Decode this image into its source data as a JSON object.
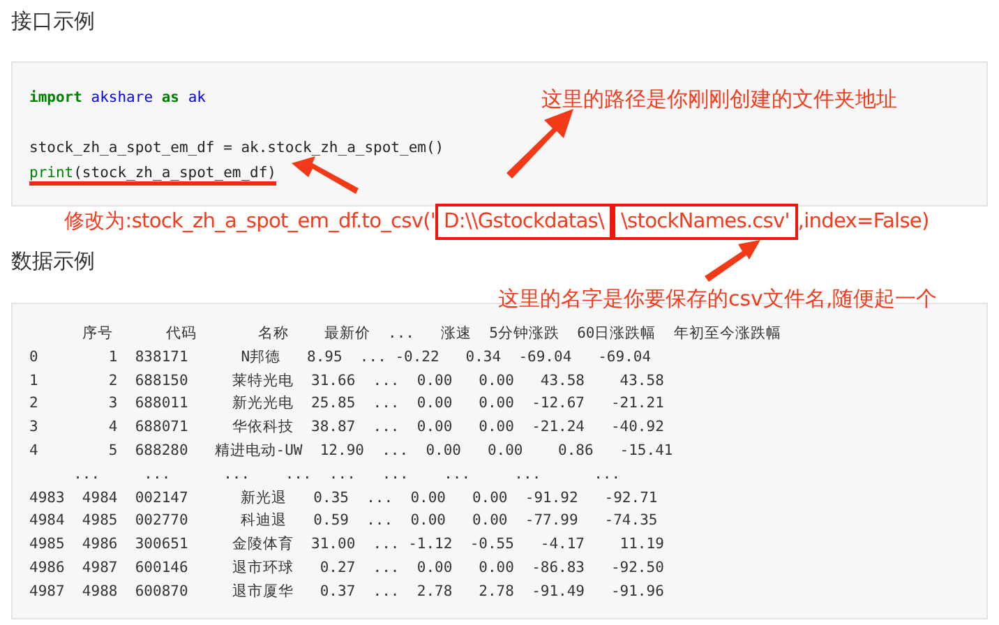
{
  "sections": [
    {
      "title": "接口示例"
    },
    {
      "title": "数据示例"
    }
  ],
  "code": {
    "blocks": [
      {
        "lines": [
          {
            "struck": false,
            "tokens": [
              {
                "kind": "keyword",
                "text": "import"
              },
              {
                "kind": "name",
                "text": "akshare"
              },
              {
                "kind": "keyword",
                "text": "as"
              },
              {
                "kind": "name",
                "text": "ak"
              }
            ]
          }
        ]
      },
      {
        "lines": [
          {
            "struck": false,
            "tokens": [
              {
                "kind": "plain",
                "text": "stock_zh_a_spot_em_df = ak.stock_zh_a_spot_em()"
              }
            ]
          },
          {
            "struck": true,
            "tokens": [
              {
                "kind": "builtin",
                "text": "print"
              },
              {
                "kind": "plain",
                "text": "(stock_zh_a_spot_em_df)"
              }
            ]
          }
        ]
      }
    ]
  },
  "output": {
    "lines": [
      "      序号      代码       名称    最新价  ...   涨速  5分钟涨跌  60日涨跌幅  年初至今涨跌幅",
      "0        1  838171      N邦德   8.95  ... -0.22   0.34  -69.04   -69.04",
      "1        2  688150     莱特光电  31.66  ...  0.00   0.00   43.58    43.58",
      "2        3  688011     新光光电  25.85  ...  0.00   0.00  -12.67   -21.21",
      "3        4  688071     华依科技  38.87  ...  0.00   0.00  -21.24   -40.92",
      "4        5  688280   精进电动-UW  12.90  ...  0.00   0.00    0.86   -15.41",
      "     ...     ...      ...    ...  ...   ...    ...     ...      ...",
      "4983  4984  002147      新光退   0.35  ...  0.00   0.00  -91.92   -92.71",
      "4984  4985  002770      科迪退   0.59  ...  0.00   0.00  -77.99   -74.35",
      "4985  4986  300651     金陵体育  31.00  ... -1.12  -0.55   -4.17    11.19",
      "4986  4987  600146     退市环球   0.27  ...  0.00   0.00  -86.83   -92.50",
      "4987  4988  600870     退市厦华   0.37  ...  2.78   2.78  -91.49   -91.96"
    ]
  },
  "annotations": [
    {
      "kind": "path_note",
      "parts": [
        {
          "text": "这里的路径是你刚刚创建的文件夹地址",
          "boxed": false
        }
      ]
    },
    {
      "kind": "change_note",
      "parts": [
        {
          "text": "修改为:stock_zh_a_spot_em_df.to_csv('",
          "boxed": false
        },
        {
          "text": "D:\\\\Gstockdatas\\",
          "boxed": true
        },
        {
          "text": "\\stockNames.csv'",
          "boxed": true
        },
        {
          "text": ",index=False)",
          "boxed": false
        }
      ]
    },
    {
      "kind": "name_note",
      "parts": [
        {
          "text": "这里的名字是你要保存的csv文件名,随便起一个",
          "boxed": false
        }
      ]
    }
  ]
}
